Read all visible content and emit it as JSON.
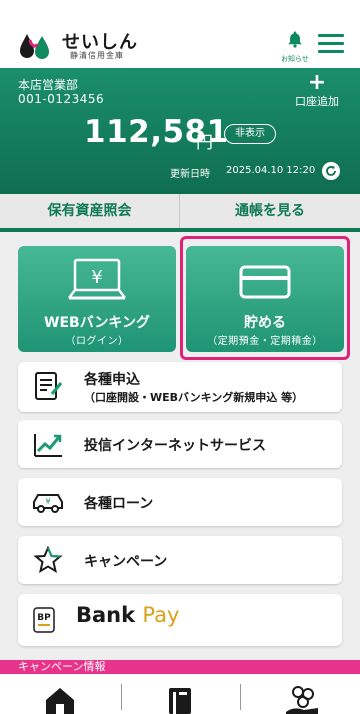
{
  "header": {
    "brand_name": "せいしん",
    "brand_sub": "静清信用金庫",
    "notice_label": "お知らせ",
    "notice_icon": "bell-icon",
    "menu_icon": "hamburger-icon"
  },
  "account": {
    "branch": "本店営業部",
    "number": "001-0123456",
    "add_label": "口座追加",
    "balance": "112,581",
    "currency": "円",
    "hide_label": "非表示",
    "updated_label": "更新日時",
    "updated_value": "2025.04.10 12:20"
  },
  "tabs": [
    "保有資産照会",
    "通帳を見る"
  ],
  "tiles": [
    {
      "title": "WEBバンキング",
      "sub": "（ログイン）",
      "icon": "computer-yen-icon"
    },
    {
      "title": "貯める",
      "sub": "（定期預金・定期積金）",
      "icon": "card-icon"
    }
  ],
  "menu_rows": [
    {
      "label": "各種申込",
      "sub": "（口座開設・WEBバンキング新規申込 等）",
      "icon": "form-icon"
    },
    {
      "label": "投信インターネットサービス",
      "icon": "chart-trend-icon"
    },
    {
      "label": "各種ローン",
      "icon": "car-yen-icon"
    },
    {
      "label": "キャンペーン",
      "icon": "star-icon"
    }
  ],
  "bankpay": {
    "bank": "Bank",
    "pay": "Pay",
    "badge": "BP"
  },
  "campaign_label": "キャンペーン情報",
  "bottom_nav": [
    "home-icon",
    "passbook-icon",
    "coins-hand-icon"
  ],
  "colors": {
    "brand_green": "#0f7a56",
    "highlight_pink": "#e0237a",
    "campaign_pink": "#e8338a",
    "bankpay_gold": "#d8a21a"
  }
}
